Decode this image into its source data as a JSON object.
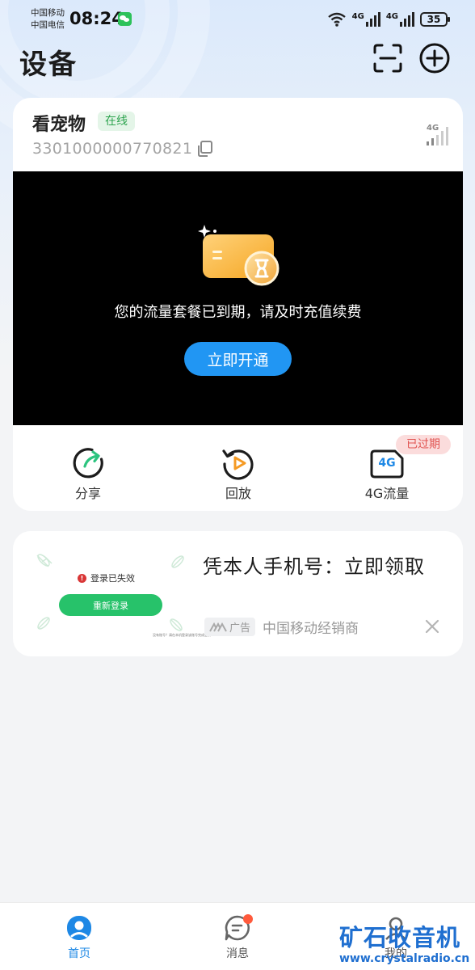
{
  "status_bar": {
    "carrier_1": "中国移动",
    "carrier_2": "中国电信",
    "time": "08:24",
    "network_1": "4G",
    "network_2": "4G",
    "battery": "35",
    "icons": [
      "wechat-icon",
      "wifi-icon",
      "signal-icon",
      "battery-icon"
    ]
  },
  "header": {
    "title": "设备",
    "icons": [
      "scan-icon",
      "add-icon"
    ]
  },
  "device": {
    "name": "看宠物",
    "status": "在线",
    "id": "3301000000770821",
    "network_type": "4G",
    "expired_message": "您的流量套餐已到期，请及时充值续费",
    "renew_button": "立即开通",
    "actions": [
      {
        "label": "分享",
        "icon": "share-icon"
      },
      {
        "label": "回放",
        "icon": "playback-icon"
      },
      {
        "label": "4G流量",
        "icon": "4g-data-icon",
        "badge": "已过期",
        "icon_text": "4G"
      }
    ]
  },
  "ad": {
    "thumb_login_expired": "登录已失效",
    "thumb_relogin": "重新登录",
    "thumb_fine_print": "没有账号？请在本机登录该账号完成登录",
    "title": "凭本人手机号：立即领取",
    "tag": "广告",
    "source": "中国移动经销商"
  },
  "bottom_nav": {
    "items": [
      {
        "label": "首页",
        "icon": "home-camera-icon",
        "active": true
      },
      {
        "label": "消息",
        "icon": "message-icon",
        "has_dot": true
      },
      {
        "label": "我的",
        "icon": "profile-icon"
      }
    ]
  },
  "watermark": {
    "name": "矿石收音机",
    "url": "www.crystalradio.cn"
  },
  "colors": {
    "accent": "#2196f3",
    "online_green": "#2ea44f",
    "expired_red": "#e0524f",
    "watermark_blue": "#1f6fd0"
  }
}
